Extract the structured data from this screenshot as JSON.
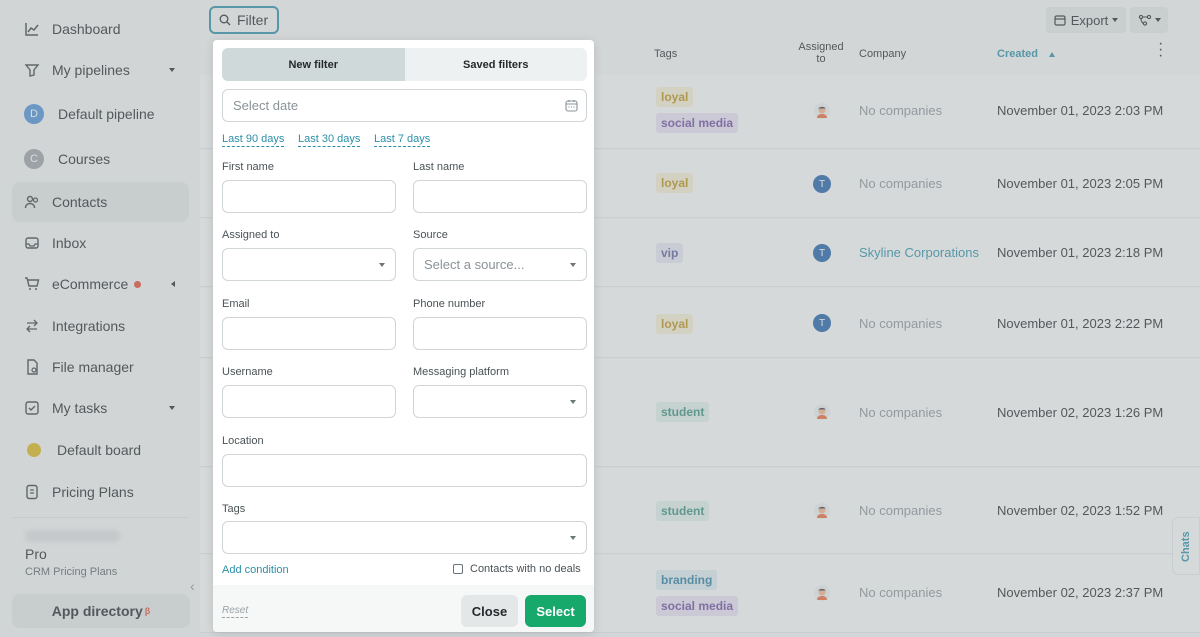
{
  "sidebar": {
    "items": [
      {
        "label": "Dashboard"
      },
      {
        "label": "My pipelines"
      },
      {
        "label": "Default pipeline",
        "initial": "D"
      },
      {
        "label": "Courses",
        "initial": "C"
      },
      {
        "label": "Contacts"
      },
      {
        "label": "Inbox"
      },
      {
        "label": "eCommerce"
      },
      {
        "label": "Integrations"
      },
      {
        "label": "File manager"
      },
      {
        "label": "My tasks"
      },
      {
        "label": "Default board"
      },
      {
        "label": "Pricing Plans"
      }
    ],
    "plan_tier": "Pro",
    "plan_name": "CRM Pricing Plans",
    "app_directory": "App directory",
    "beta_mark": "β"
  },
  "toolbar": {
    "filter_label": "Filter",
    "export_label": "Export"
  },
  "table": {
    "headers": {
      "tags": "Tags",
      "assigned_to": "Assigned to",
      "company": "Company",
      "created": "Created"
    },
    "rows": [
      {
        "tags": [
          "loyal",
          "social media"
        ],
        "assignee": "avatar",
        "company": "No companies",
        "created": "November 01, 2023 2:03 PM"
      },
      {
        "tags": [
          "loyal"
        ],
        "assignee": "T",
        "company": "No companies",
        "created": "November 01, 2023 2:05 PM"
      },
      {
        "tags": [
          "vip"
        ],
        "assignee": "T",
        "company": "Skyline Corporations",
        "created": "November 01, 2023 2:18 PM"
      },
      {
        "tags": [
          "loyal"
        ],
        "assignee": "T",
        "company": "No companies",
        "created": "November 01, 2023 2:22 PM"
      },
      {
        "tags": [
          "student"
        ],
        "assignee": "avatar",
        "company": "No companies",
        "created": "November 02, 2023 1:26 PM"
      },
      {
        "tags": [
          "student"
        ],
        "assignee": "avatar",
        "company": "No companies",
        "created": "November 02, 2023 1:52 PM"
      },
      {
        "tags": [
          "branding",
          "social media"
        ],
        "assignee": "avatar",
        "company": "No companies",
        "created": "November 02, 2023 2:37 PM"
      }
    ]
  },
  "chats_label": "Chats",
  "filter_panel": {
    "tab_new": "New filter",
    "tab_saved": "Saved filters",
    "date_placeholder": "Select date",
    "quick_ranges": [
      "Last 90 days",
      "Last 30 days",
      "Last 7 days"
    ],
    "labels": {
      "first_name": "First name",
      "last_name": "Last name",
      "assigned_to": "Assigned to",
      "source": "Source",
      "email": "Email",
      "phone": "Phone number",
      "username": "Username",
      "messaging": "Messaging platform",
      "location": "Location",
      "tags": "Tags"
    },
    "source_placeholder": "Select a source...",
    "add_condition": "Add condition",
    "no_deals": "Contacts with no deals",
    "reset": "Reset",
    "close": "Close",
    "select": "Select"
  },
  "colors": {
    "accent": "#2b8fa8",
    "primary_button": "#17a86b",
    "badge_red": "#e04a32",
    "assignee_blue": "#1f5fa8"
  }
}
